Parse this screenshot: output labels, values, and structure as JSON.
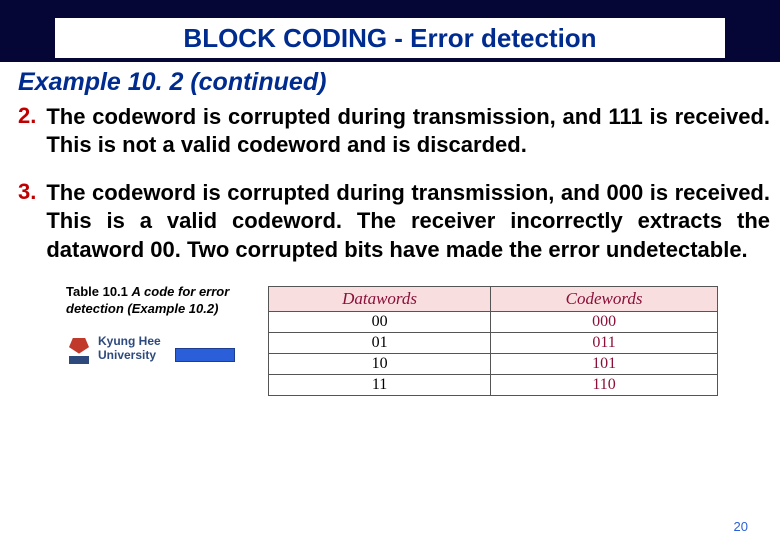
{
  "header": {
    "title": "BLOCK CODING - Error detection"
  },
  "example_heading": "Example 10. 2 (continued)",
  "items": [
    {
      "num": "2.",
      "text": "The codeword is corrupted during transmission, and 111 is received. This is not a valid codeword and is discarded."
    },
    {
      "num": "3.",
      "text": "The codeword is corrupted during transmission, and 000 is received. This is a valid codeword. The receiver incorrectly extracts the dataword 00. Two corrupted bits have made the error undetectable."
    }
  ],
  "table_caption": {
    "label": "Table 10.1",
    "desc": "A code for error detection (Example 10.2)"
  },
  "university": {
    "line1": "Kyung Hee",
    "line2": "University"
  },
  "table": {
    "headers": [
      "Datawords",
      "Codewords"
    ],
    "rows": [
      [
        "00",
        "000"
      ],
      [
        "01",
        "011"
      ],
      [
        "10",
        "101"
      ],
      [
        "11",
        "110"
      ]
    ]
  },
  "page_number": "20",
  "chart_data": {
    "type": "table",
    "title": "A code for error detection (Example 10.2)",
    "columns": [
      "Datawords",
      "Codewords"
    ],
    "rows": [
      {
        "Datawords": "00",
        "Codewords": "000"
      },
      {
        "Datawords": "01",
        "Codewords": "011"
      },
      {
        "Datawords": "10",
        "Codewords": "101"
      },
      {
        "Datawords": "11",
        "Codewords": "110"
      }
    ]
  }
}
